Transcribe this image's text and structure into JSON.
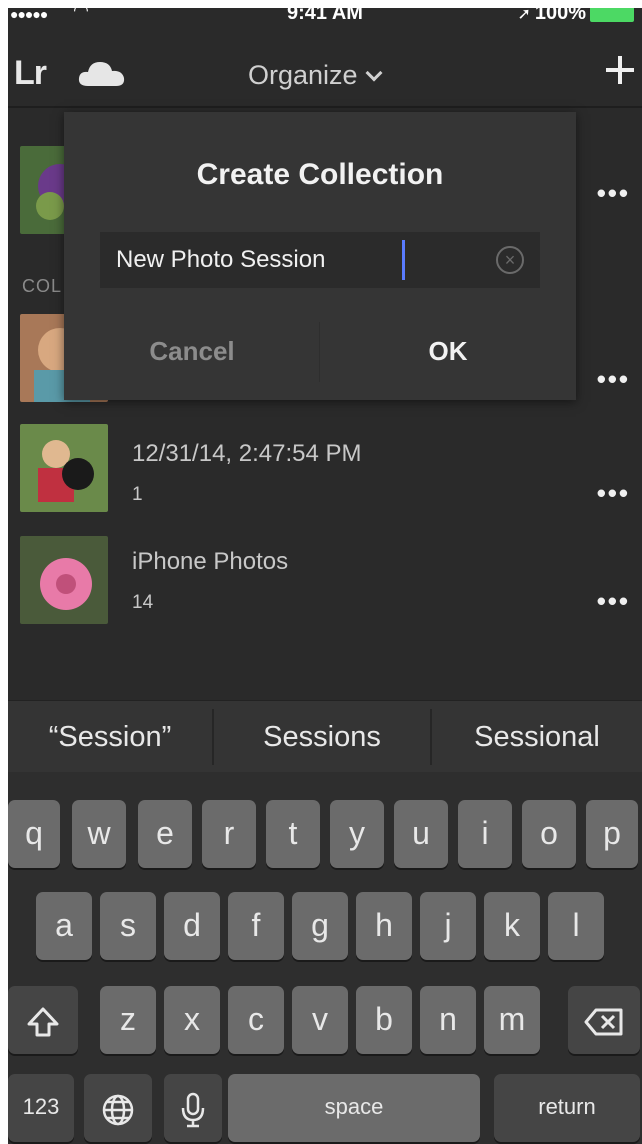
{
  "status_bar": {
    "time": "9:41 AM",
    "battery": "100%"
  },
  "nav": {
    "logo": "Lr",
    "title": "Organize"
  },
  "list": {
    "section_label": "COL",
    "rows": [
      {
        "title": "",
        "count": ""
      },
      {
        "title": "",
        "count": ""
      },
      {
        "title": "12/31/14, 2:47:54 PM",
        "count": "1"
      },
      {
        "title": "iPhone Photos",
        "count": "14"
      }
    ]
  },
  "dialog": {
    "title": "Create Collection",
    "input_value": "New Photo Session",
    "cancel_label": "Cancel",
    "ok_label": "OK"
  },
  "predictive": [
    "“Session”",
    "Sessions",
    "Sessional"
  ],
  "keyboard": {
    "row1": [
      "q",
      "w",
      "e",
      "r",
      "t",
      "y",
      "u",
      "i",
      "o",
      "p"
    ],
    "row2": [
      "a",
      "s",
      "d",
      "f",
      "g",
      "h",
      "j",
      "k",
      "l"
    ],
    "row3": [
      "z",
      "x",
      "c",
      "v",
      "b",
      "n",
      "m"
    ],
    "numbers_label": "123",
    "space_label": "space",
    "return_label": "return"
  },
  "colors": {
    "background": "#2a2a2a",
    "dialog": "#353535",
    "key": "#6b6b6b",
    "caret": "#5a7cff"
  }
}
